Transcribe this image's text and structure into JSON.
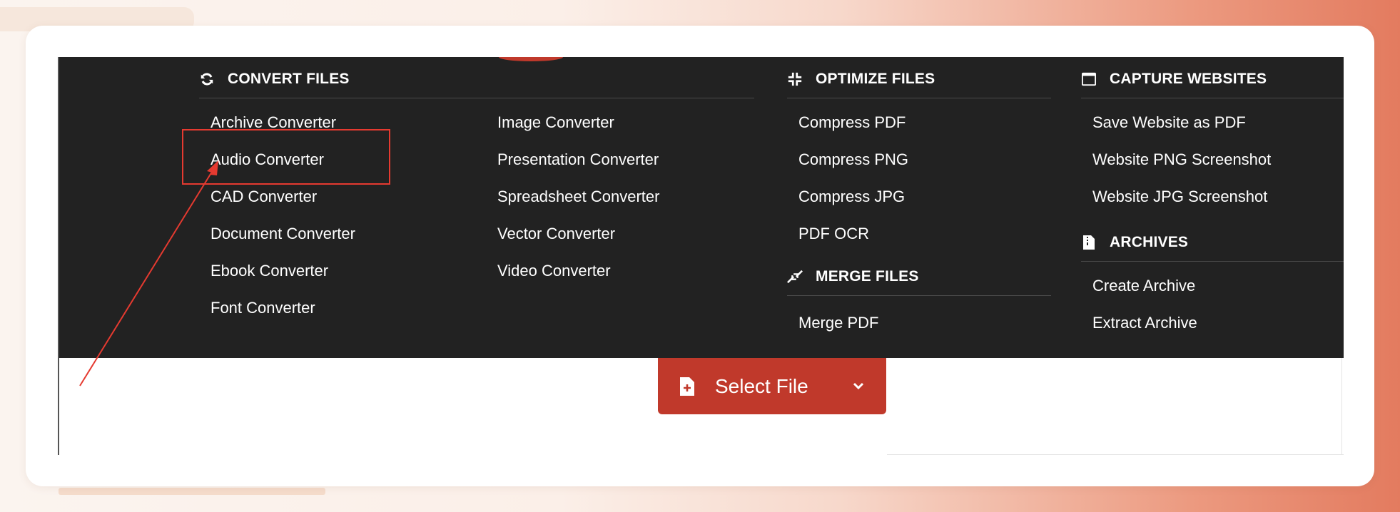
{
  "menu": {
    "convert": {
      "title": "CONVERT FILES",
      "icon": "refresh-icon",
      "col1": [
        "Archive Converter",
        "Audio Converter",
        "CAD Converter",
        "Document Converter",
        "Ebook Converter",
        "Font Converter"
      ],
      "col2": [
        "Image Converter",
        "Presentation Converter",
        "Spreadsheet Converter",
        "Vector Converter",
        "Video Converter"
      ]
    },
    "optimize": {
      "title": "OPTIMIZE FILES",
      "icon": "compress-icon",
      "items": [
        "Compress PDF",
        "Compress PNG",
        "Compress JPG",
        "PDF OCR"
      ]
    },
    "merge": {
      "title": "MERGE FILES",
      "icon": "merge-icon",
      "items": [
        "Merge PDF"
      ]
    },
    "capture": {
      "title": "CAPTURE WEBSITES",
      "icon": "browser-window-icon",
      "items": [
        "Save Website as PDF",
        "Website PNG Screenshot",
        "Website JPG Screenshot"
      ]
    },
    "archives": {
      "title": "ARCHIVES",
      "icon": "archive-file-icon",
      "items": [
        "Create Archive",
        "Extract Archive"
      ]
    }
  },
  "select_file": {
    "label": "Select File",
    "icon": "file-add-icon",
    "chevron": "chevron-down-icon"
  },
  "annotation": {
    "highlighted_item": "Audio Converter",
    "color": "#e53a30"
  },
  "colors": {
    "menu_bg": "#222222",
    "accent": "#c0392b",
    "text": "#ffffff"
  }
}
